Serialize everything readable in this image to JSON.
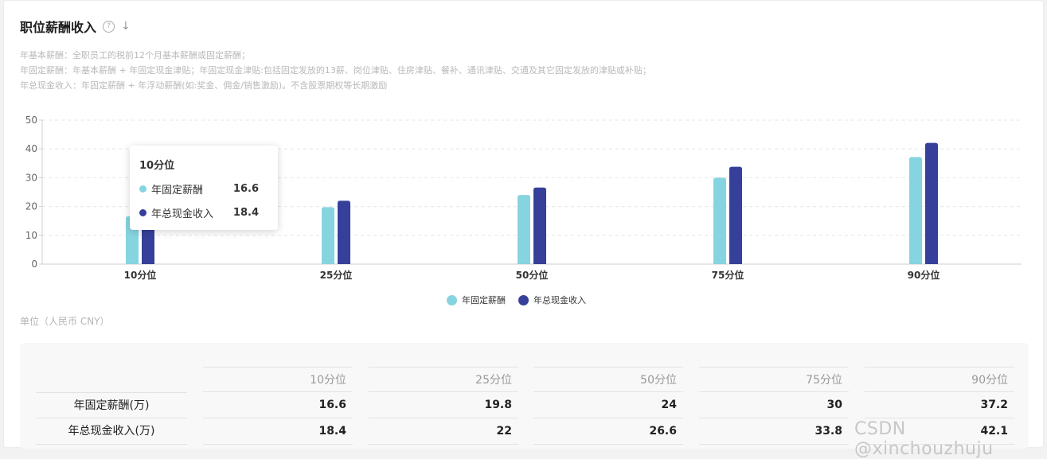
{
  "header": {
    "title": "职位薪酬收入",
    "help_icon": "?",
    "download_icon": "↓"
  },
  "notes": [
    "年基本薪酬：全职员工的税前12个月基本薪酬或固定薪酬；",
    "年固定薪酬：年基本薪酬 + 年固定现金津贴；年固定现金津贴:包括固定发放的13薪、岗位津贴、住房津贴、餐补、通讯津贴、交通及其它固定发放的津贴或补贴；",
    "年总现金收入：年固定薪酬 + 年浮动薪酬(如:奖金、佣金/销售激励)。不含股票期权等长期激励"
  ],
  "unit_label": "单位（人民币 CNY）",
  "chart_data": {
    "type": "bar",
    "categories": [
      "10分位",
      "25分位",
      "50分位",
      "75分位",
      "90分位"
    ],
    "series": [
      {
        "name": "年固定薪酬",
        "color": "#86d4e0",
        "values": [
          16.6,
          19.8,
          24,
          30,
          37.2
        ]
      },
      {
        "name": "年总现金收入",
        "color": "#36409a",
        "values": [
          18.4,
          22,
          26.6,
          33.8,
          42.1
        ]
      }
    ],
    "ylim": [
      0,
      50
    ],
    "yticks": [
      0,
      10,
      20,
      30,
      40,
      50
    ],
    "grid": true,
    "legend": "bottom-center"
  },
  "tooltip": {
    "title": "10分位",
    "rows": [
      {
        "name": "年固定薪酬",
        "value": "16.6",
        "color": "#86d4e0"
      },
      {
        "name": "年总现金收入",
        "value": "18.4",
        "color": "#36409a"
      }
    ]
  },
  "table": {
    "columns": [
      "10分位",
      "25分位",
      "50分位",
      "75分位",
      "90分位"
    ],
    "rows": [
      {
        "label": "年固定薪酬(万)",
        "values": [
          "16.6",
          "19.8",
          "24",
          "30",
          "37.2"
        ]
      },
      {
        "label": "年总现金收入(万)",
        "values": [
          "18.4",
          "22",
          "26.6",
          "33.8",
          "42.1"
        ]
      }
    ]
  },
  "watermark": "CSDN @xinchouzhuju"
}
